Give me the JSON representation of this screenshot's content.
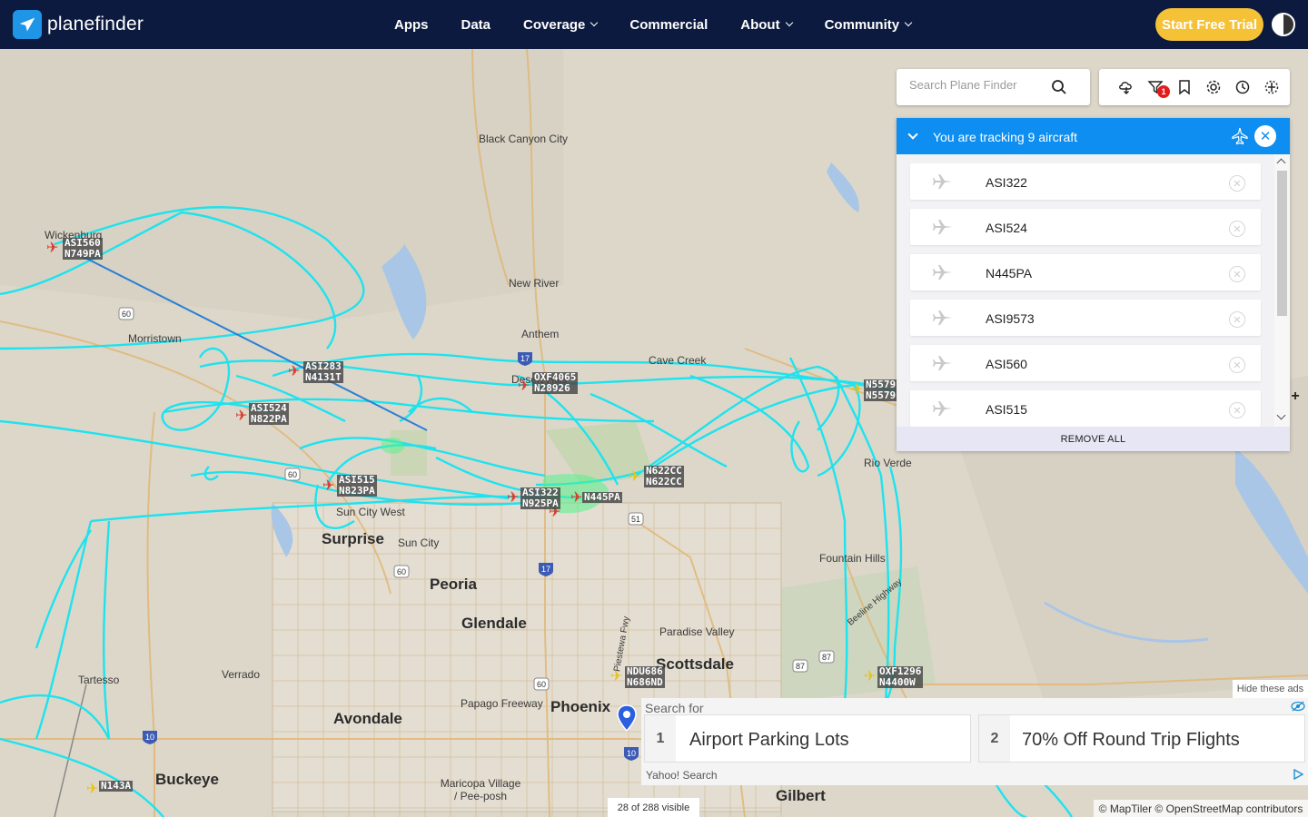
{
  "brand": {
    "name": "planefinder"
  },
  "nav": {
    "items": [
      {
        "label": "Apps",
        "dropdown": false
      },
      {
        "label": "Data",
        "dropdown": false
      },
      {
        "label": "Coverage",
        "dropdown": true
      },
      {
        "label": "Commercial",
        "dropdown": false
      },
      {
        "label": "About",
        "dropdown": true
      },
      {
        "label": "Community",
        "dropdown": true
      }
    ],
    "cta": "Start Free Trial"
  },
  "search": {
    "placeholder": "Search Plane Finder"
  },
  "toolbar": {
    "icons": [
      "cloud-layers-icon",
      "filter-icon",
      "bookmark-icon",
      "settings-icon",
      "history-icon",
      "airport-icon"
    ],
    "filter_badge": "1"
  },
  "tracking": {
    "title": "You are tracking 9 aircraft",
    "items": [
      "ASI322",
      "ASI524",
      "N445PA",
      "ASI9573",
      "ASI560",
      "ASI515"
    ],
    "remove_all": "REMOVE ALL"
  },
  "map": {
    "places": [
      "Black Canyon City",
      "Wickenburg",
      "New River",
      "Anthem",
      "Cave Creek",
      "Morristown",
      "Rio Verde",
      "Fountain Hills",
      "Paradise Valley",
      "Tartesso",
      "Verrado",
      "Papago Freeway",
      "Maricopa Village / Pee-posh",
      "Sun City West",
      "Sun City",
      "Desert Hills",
      "Piestewa Fwy",
      "Beeline Highway"
    ],
    "cities": [
      "Surprise",
      "Peoria",
      "Glendale",
      "Scottsdale",
      "Phoenix",
      "Avondale",
      "Buckeye",
      "Gilbert"
    ],
    "highways": [
      "60",
      "17",
      "60",
      "60",
      "17",
      "51",
      "60",
      "10",
      "10",
      "87",
      "87"
    ],
    "aircraft_tags": [
      "ASI560\nN749PA",
      "ASI283\nN4131T",
      "OXF4065\nN28926",
      "ASI524\nN822PA",
      "ASI515\nN823PA",
      "ASI322\nN925PA",
      "N445PA",
      "N622CC\nN622CC",
      "N5579\nN5579",
      "NDU686\nN686ND",
      "OXF1296\nN4400W",
      "N143A"
    ],
    "visible_count": "28 of 288 visible",
    "attribution": "© MapTiler © OpenStreetMap contributors",
    "zoom_in": "+"
  },
  "ads": {
    "hide_label": "Hide these ads",
    "search_for": "Search for",
    "items": [
      {
        "num": "1",
        "text": "Airport Parking Lots"
      },
      {
        "num": "2",
        "text": "70% Off Round Trip Flights"
      }
    ],
    "provider": "Yahoo! Search"
  },
  "colors": {
    "nav_bg": "#0c1a3f",
    "accent": "#0d8ef0",
    "cta": "#f5c136",
    "track": "#1ee3ee"
  }
}
